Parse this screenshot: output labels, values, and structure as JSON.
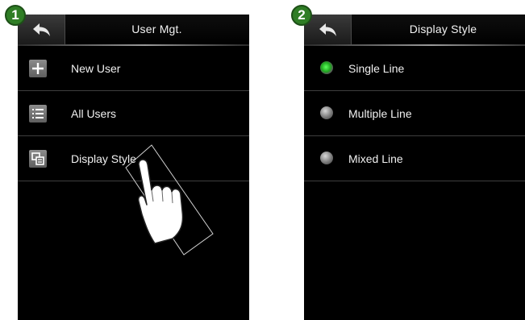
{
  "steps": {
    "step1": "1",
    "step2": "2"
  },
  "screen1": {
    "title": "User Mgt.",
    "items": [
      {
        "label": "New User",
        "icon": "plus-icon"
      },
      {
        "label": "All Users",
        "icon": "list-icon"
      },
      {
        "label": "Display Style",
        "icon": "display-style-icon"
      }
    ]
  },
  "screen2": {
    "title": "Display Style",
    "options": [
      {
        "label": "Single Line",
        "selected": true
      },
      {
        "label": "Multiple Line",
        "selected": false
      },
      {
        "label": "Mixed Line",
        "selected": false
      }
    ]
  },
  "colors": {
    "accent_green": "#2f7d25",
    "radio_selected": "#3fd43f",
    "screen_bg": "#000000"
  }
}
